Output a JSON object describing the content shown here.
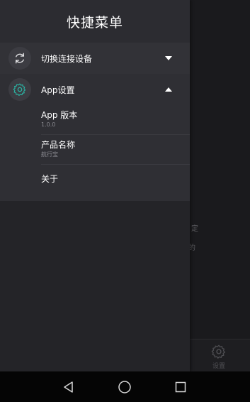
{
  "background_app": {
    "fragment_text_1": "定",
    "fragment_text_2": "的",
    "tab_settings_label": "设置"
  },
  "drawer": {
    "title": "快捷菜单",
    "switch_device": {
      "label": "切换连接设备",
      "icon": "sync-icon"
    },
    "app_settings": {
      "label": "App设置",
      "icon": "gear-icon",
      "items": [
        {
          "title": "App 版本",
          "value": "1.0.0"
        },
        {
          "title": "产品名称",
          "value": "航行宝"
        },
        {
          "title": "关于",
          "value": ""
        }
      ]
    }
  },
  "nav_bar": {
    "back": "back-icon",
    "home": "home-icon",
    "recents": "recents-icon"
  },
  "colors": {
    "accent": "#2bb3a3",
    "drawer_bg": "#242428",
    "header_bg": "#2c2c31"
  }
}
